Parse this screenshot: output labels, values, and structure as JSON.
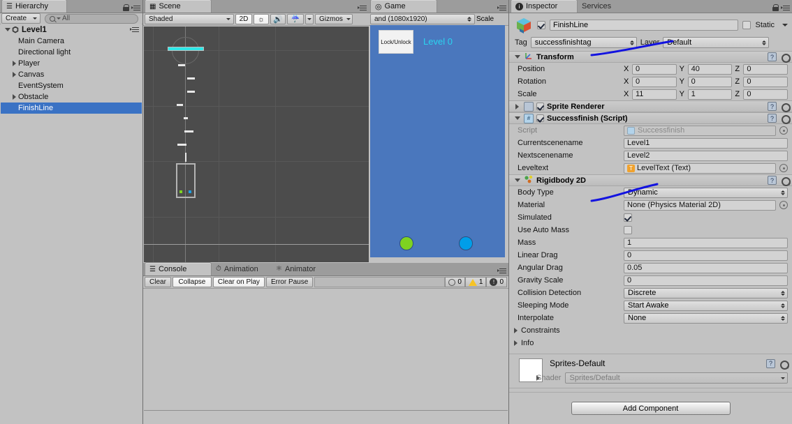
{
  "hierarchy": {
    "tab": "Hierarchy",
    "create_label": "Create",
    "search_placeholder": "All",
    "root": "Level1",
    "items": [
      {
        "label": "Main Camera",
        "arrow": "none",
        "selected": false
      },
      {
        "label": "Directional light",
        "arrow": "none",
        "selected": false
      },
      {
        "label": "Player",
        "arrow": "closed",
        "selected": false
      },
      {
        "label": "Canvas",
        "arrow": "closed",
        "selected": false
      },
      {
        "label": "EventSystem",
        "arrow": "none",
        "selected": false
      },
      {
        "label": "Obstacle",
        "arrow": "closed",
        "selected": false
      },
      {
        "label": "FinishLine",
        "arrow": "none",
        "selected": true
      }
    ]
  },
  "scene": {
    "tab": "Scene",
    "draw_mode": "Shaded",
    "two_d": "2D",
    "lighting_icon": "sun-icon",
    "audio_icon": "speaker-icon",
    "effects_icon": "image-icon",
    "gizmos": "Gizmos"
  },
  "game": {
    "tab": "Game",
    "aspect": "and (1080x1920)",
    "scale_label": "Scale",
    "button_label": "Lock/Unlock",
    "level_text": "Level 0",
    "level_text_color": "#2ad4f0",
    "bg_color": "#4a77bd",
    "player_color": "#7ed321",
    "goal_color": "#009ee8"
  },
  "console": {
    "tabs": [
      {
        "label": "Console",
        "active": true
      },
      {
        "label": "Animation",
        "active": false
      },
      {
        "label": "Animator",
        "active": false
      }
    ],
    "buttons": [
      {
        "label": "Clear",
        "toggled": false
      },
      {
        "label": "Collapse",
        "toggled": true
      },
      {
        "label": "Clear on Play",
        "toggled": true
      },
      {
        "label": "Error Pause",
        "toggled": false
      }
    ],
    "counts": {
      "info": "0",
      "warning": "1",
      "error": "0"
    }
  },
  "inspector": {
    "tabs": [
      {
        "label": "Inspector",
        "active": true
      },
      {
        "label": "Services",
        "active": false
      }
    ],
    "object_name": "FinishLine",
    "enabled": true,
    "static_label": "Static",
    "static_checked": false,
    "tag_label": "Tag",
    "tag_value": "successfinishtag",
    "layer_label": "Layer",
    "layer_value": "Default",
    "transform": {
      "title": "Transform",
      "rows": [
        {
          "name": "Position",
          "x": "0",
          "y": "40",
          "z": "0"
        },
        {
          "name": "Rotation",
          "x": "0",
          "y": "0",
          "z": "0"
        },
        {
          "name": "Scale",
          "x": "11",
          "y": "1",
          "z": "0"
        }
      ],
      "axis_labels": [
        "X",
        "Y",
        "Z"
      ]
    },
    "sprite_renderer": {
      "title": "Sprite Renderer",
      "enabled": true,
      "expanded": false
    },
    "script_component": {
      "title": "Successfinish (Script)",
      "enabled": true,
      "script_label": "Script",
      "script_value": "Successfinish",
      "fields": [
        {
          "name": "Currentscenename",
          "value": "Level1",
          "type": "text"
        },
        {
          "name": "Nextscenename",
          "value": "Level2",
          "type": "text"
        },
        {
          "name": "Leveltext",
          "value": "LevelText (Text)",
          "type": "object"
        }
      ]
    },
    "rigidbody": {
      "title": "Rigidbody 2D",
      "rows": [
        {
          "name": "Body Type",
          "value": "Dynamic",
          "type": "dropdown"
        },
        {
          "name": "Material",
          "value": "None (Physics Material 2D)",
          "type": "object"
        },
        {
          "name": "Simulated",
          "value": "",
          "type": "checkbox",
          "checked": true
        },
        {
          "name": "Use Auto Mass",
          "value": "",
          "type": "checkbox",
          "checked": false
        },
        {
          "name": "Mass",
          "value": "1",
          "type": "text"
        },
        {
          "name": "Linear Drag",
          "value": "0",
          "type": "text"
        },
        {
          "name": "Angular Drag",
          "value": "0.05",
          "type": "text"
        },
        {
          "name": "Gravity Scale",
          "value": "0",
          "type": "text"
        },
        {
          "name": "Collision Detection",
          "value": "Discrete",
          "type": "dropdown"
        },
        {
          "name": "Sleeping Mode",
          "value": "Start Awake",
          "type": "dropdown"
        },
        {
          "name": "Interpolate",
          "value": "None",
          "type": "dropdown"
        }
      ],
      "foldouts": [
        "Constraints",
        "Info"
      ]
    },
    "material": {
      "name": "Sprites-Default",
      "shader_label": "Shader",
      "shader_value": "Sprites/Default"
    },
    "add_component": "Add Component"
  },
  "colors": {
    "panel_bg": "#c2c2c2",
    "tabbar_bg": "#9c9c9c",
    "selection_blue": "#3a72c4",
    "annotation_blue": "#1313e0",
    "scene_bg": "#4c4c4c",
    "finishline_cyan": "#2ee8e8"
  }
}
